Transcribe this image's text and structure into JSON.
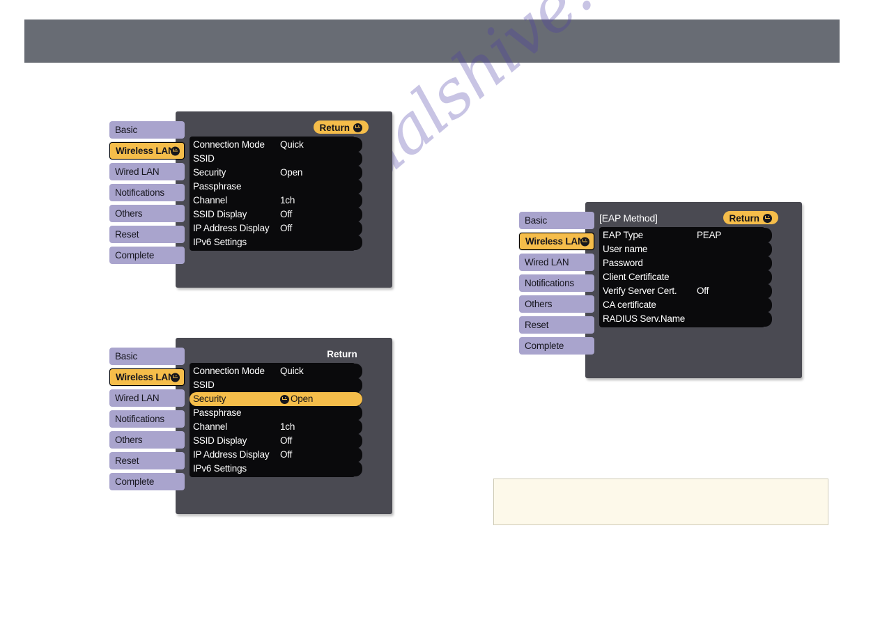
{
  "page": {
    "watermark_text": "manualshive.com",
    "header_band_color": "#686c74",
    "accent_color": "#f5bd4a",
    "tab_color": "#a9a4cd",
    "panel_color": "#4a4a52",
    "list_color": "#0a0a0c",
    "note_bg_color": "#fdf9ea"
  },
  "sidebar_tabs": [
    {
      "label": "Basic",
      "active": false
    },
    {
      "label": "Wireless LAN",
      "active": true,
      "icon": "enter-icon"
    },
    {
      "label": "Wired LAN",
      "active": false
    },
    {
      "label": "Notifications",
      "active": false
    },
    {
      "label": "Others",
      "active": false
    },
    {
      "label": "Reset",
      "active": false
    },
    {
      "label": "Complete",
      "active": false
    }
  ],
  "menu_one": {
    "title": "",
    "return_label": "Return",
    "return_icon": "enter-icon",
    "rows": [
      {
        "label": "Connection Mode",
        "value": "Quick",
        "selected": false
      },
      {
        "label": "SSID",
        "value": "",
        "selected": false
      },
      {
        "label": "Security",
        "value": "Open",
        "selected": false
      },
      {
        "label": "Passphrase",
        "value": "",
        "selected": false
      },
      {
        "label": "Channel",
        "value": "1ch",
        "selected": false
      },
      {
        "label": "SSID Display",
        "value": "Off",
        "selected": false
      },
      {
        "label": "IP Address Display",
        "value": "Off",
        "selected": false
      },
      {
        "label": "IPv6 Settings",
        "value": "",
        "selected": false
      }
    ]
  },
  "menu_two": {
    "title": "",
    "return_label": "Return",
    "return_icon": "none",
    "rows": [
      {
        "label": "Connection Mode",
        "value": "Quick",
        "selected": false
      },
      {
        "label": "SSID",
        "value": "",
        "selected": false
      },
      {
        "label": "Security",
        "value": "Open",
        "selected": true,
        "value_icon": "enter-icon"
      },
      {
        "label": "Passphrase",
        "value": "",
        "selected": false
      },
      {
        "label": "Channel",
        "value": "1ch",
        "selected": false
      },
      {
        "label": "SSID Display",
        "value": "Off",
        "selected": false
      },
      {
        "label": "IP Address Display",
        "value": "Off",
        "selected": false
      },
      {
        "label": "IPv6 Settings",
        "value": "",
        "selected": false
      }
    ]
  },
  "menu_three": {
    "title": "[EAP Method]",
    "return_label": "Return",
    "return_icon": "enter-icon",
    "rows": [
      {
        "label": "EAP Type",
        "value": "PEAP",
        "selected": false
      },
      {
        "label": "User name",
        "value": "",
        "selected": false
      },
      {
        "label": "Password",
        "value": "",
        "selected": false
      },
      {
        "label": "Client Certificate",
        "value": "",
        "selected": false
      },
      {
        "label": "Verify Server Cert.",
        "value": "Off",
        "selected": false
      },
      {
        "label": "CA certificate",
        "value": "",
        "selected": false
      },
      {
        "label": "RADIUS Serv.Name",
        "value": "",
        "selected": false
      }
    ]
  },
  "note_box": {
    "text": ""
  }
}
